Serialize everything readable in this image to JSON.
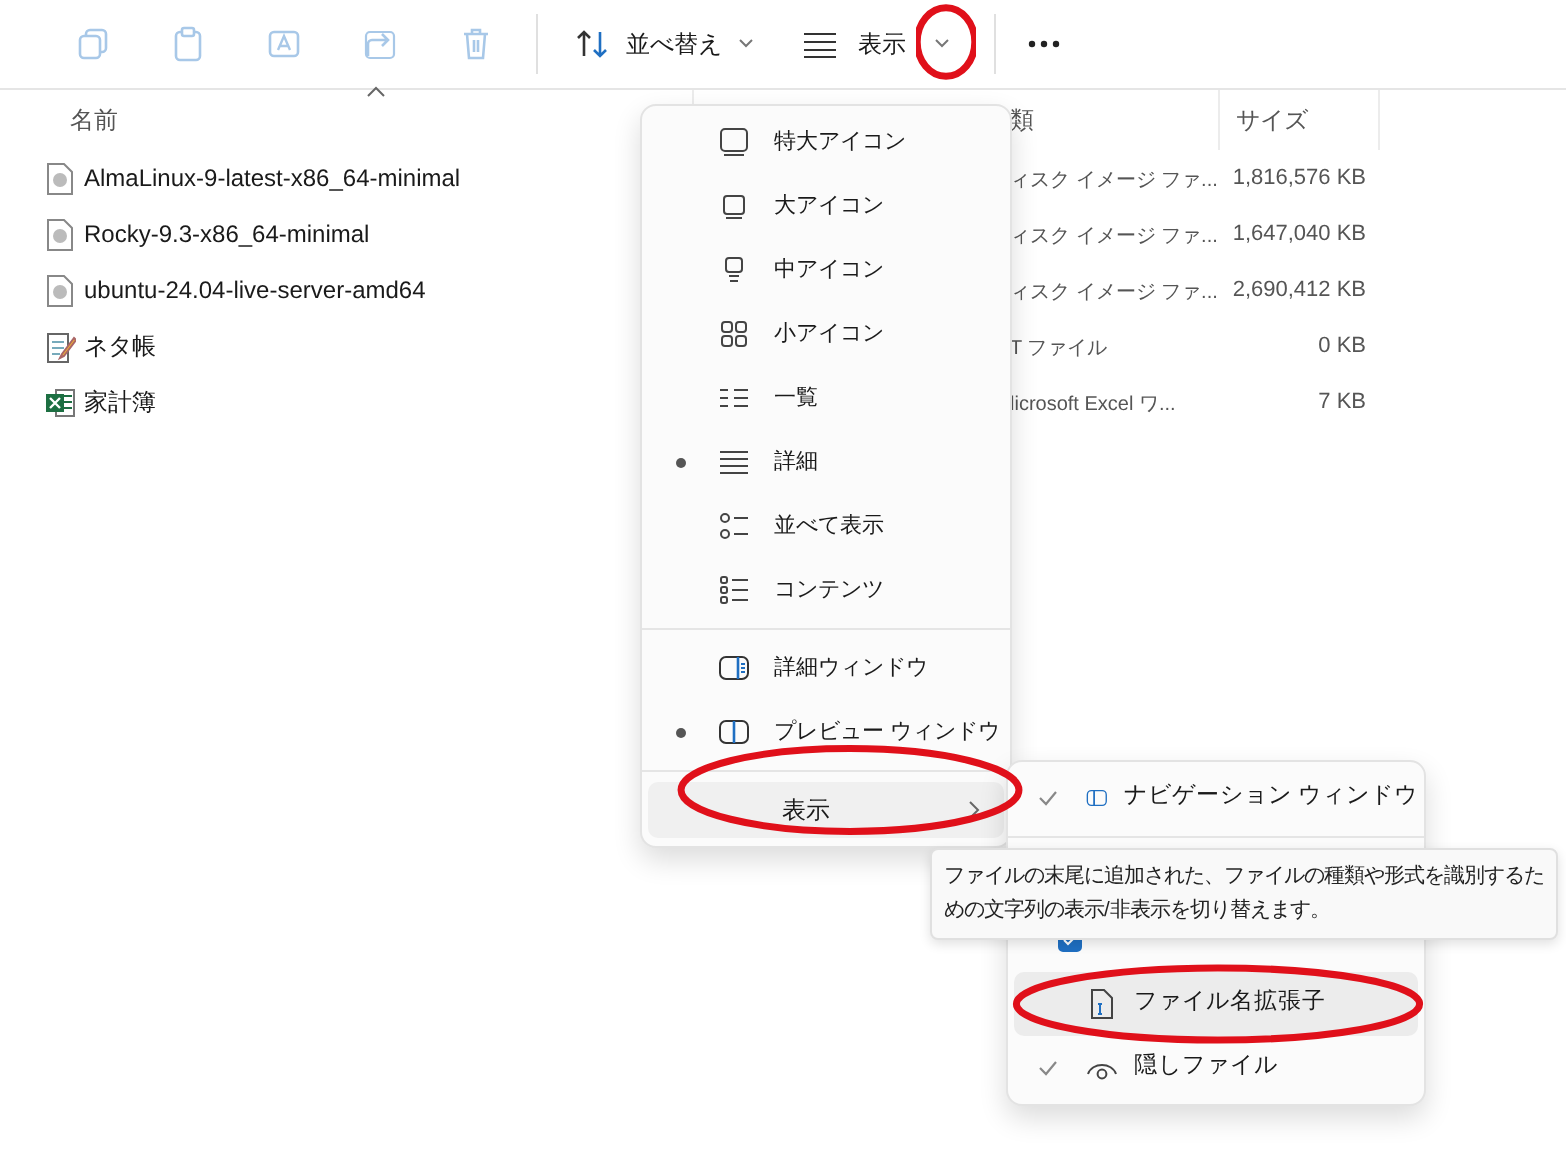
{
  "toolbar": {
    "icon_buttons": [
      {
        "disabled": true
      },
      {
        "disabled": true
      },
      {
        "disabled": true
      },
      {
        "disabled": true
      },
      {
        "disabled": true
      }
    ],
    "sort": {
      "label": "並べ替え"
    },
    "view": {
      "label": "表示",
      "highlighted": true
    }
  },
  "columns": [
    {
      "label": "名前",
      "sorted": true
    },
    {
      "label": "類",
      "sorted": false
    },
    {
      "label": "サイズ",
      "sorted": false
    }
  ],
  "rows": [
    {
      "kind": "disc",
      "name": "AlmaLinux-9-latest-x86_64-minimal",
      "type": "ィスク イメージ ファ...",
      "size": "1,816,576 KB"
    },
    {
      "kind": "disc",
      "name": "Rocky-9.3-x86_64-minimal",
      "type": "ィスク イメージ ファ...",
      "size": "1,647,040 KB"
    },
    {
      "kind": "disc",
      "name": "ubuntu-24.04-live-server-amd64",
      "type": "ィスク イメージ ファ...",
      "size": "2,690,412 KB"
    },
    {
      "kind": "text",
      "name": "ネタ帳",
      "type": "T ファイル",
      "size": "0 KB"
    },
    {
      "kind": "excel",
      "name": "家計簿",
      "type": "licrosoft Excel ワ...",
      "size": "7 KB"
    }
  ],
  "view_menu": {
    "items": [
      {
        "kind": "layout",
        "label": "特大アイコン",
        "selected": false
      },
      {
        "kind": "layout",
        "label": "大アイコン",
        "selected": false
      },
      {
        "kind": "layout",
        "label": "中アイコン",
        "selected": false
      },
      {
        "kind": "layout",
        "label": "小アイコン",
        "selected": false
      },
      {
        "kind": "layout",
        "label": "一覧",
        "selected": false
      },
      {
        "kind": "layout",
        "label": "詳細",
        "selected": true
      },
      {
        "kind": "layout",
        "label": "並べて表示",
        "selected": false
      },
      {
        "kind": "layout",
        "label": "コンテンツ",
        "selected": false
      },
      {
        "kind": "divider"
      },
      {
        "kind": "pane",
        "label": "詳細ウィンドウ",
        "selected": false
      },
      {
        "kind": "pane",
        "label": "プレビュー ウィンドウ",
        "selected": true
      },
      {
        "kind": "divider"
      },
      {
        "kind": "submenu",
        "label": "表示",
        "highlighted": true
      }
    ]
  },
  "show_submenu": {
    "items": [
      {
        "kind": "check",
        "label": "ナビゲーション ウィンドウ",
        "checked": true,
        "highlighted": false
      },
      {
        "kind": "divider"
      },
      {
        "kind": "checkbox",
        "checked": true
      },
      {
        "kind": "check",
        "label": "ファイル名拡張子",
        "checked": false,
        "highlighted": true
      },
      {
        "kind": "check",
        "label": "隠しファイル",
        "checked": true,
        "highlighted": false
      }
    ]
  },
  "tooltip": {
    "text": "ファイルの末尾に追加された、ファイルの種類や形式を識別するための文字列の表示/非表示を切り替えます。"
  }
}
